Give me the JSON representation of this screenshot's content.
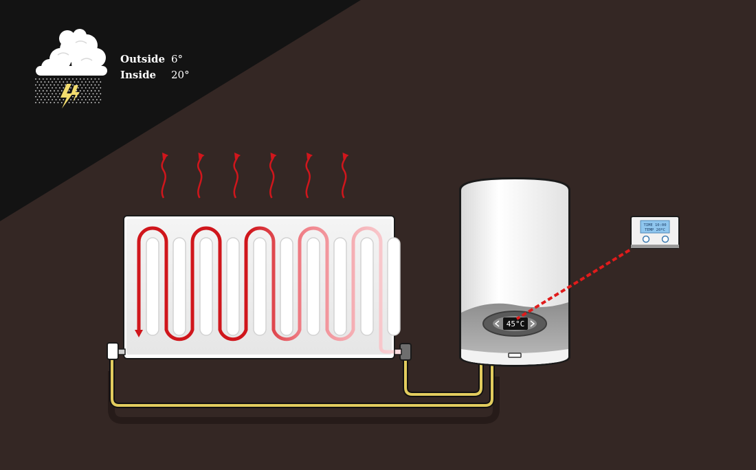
{
  "colors": {
    "background": "#342724",
    "night_corner": "#131313",
    "heat_red": "#d0161c",
    "pipe_yellow": "#e2cc5e",
    "signal_red": "#e01b1b",
    "thermostat_screen": "#8fc6ee"
  },
  "weather": {
    "icon": "storm-cloud-icon",
    "outside_label": "Outside",
    "outside_value": "6°",
    "inside_label": "Inside",
    "inside_value": "20°"
  },
  "radiator": {
    "heat_wave_count": 6,
    "icon": "radiator-icon"
  },
  "boiler": {
    "display_temp": "45°C",
    "icon": "boiler-icon"
  },
  "thermostat": {
    "line1": "TIME 10:00",
    "line2": "TEMP 20ºC",
    "icon": "thermostat-icon"
  }
}
